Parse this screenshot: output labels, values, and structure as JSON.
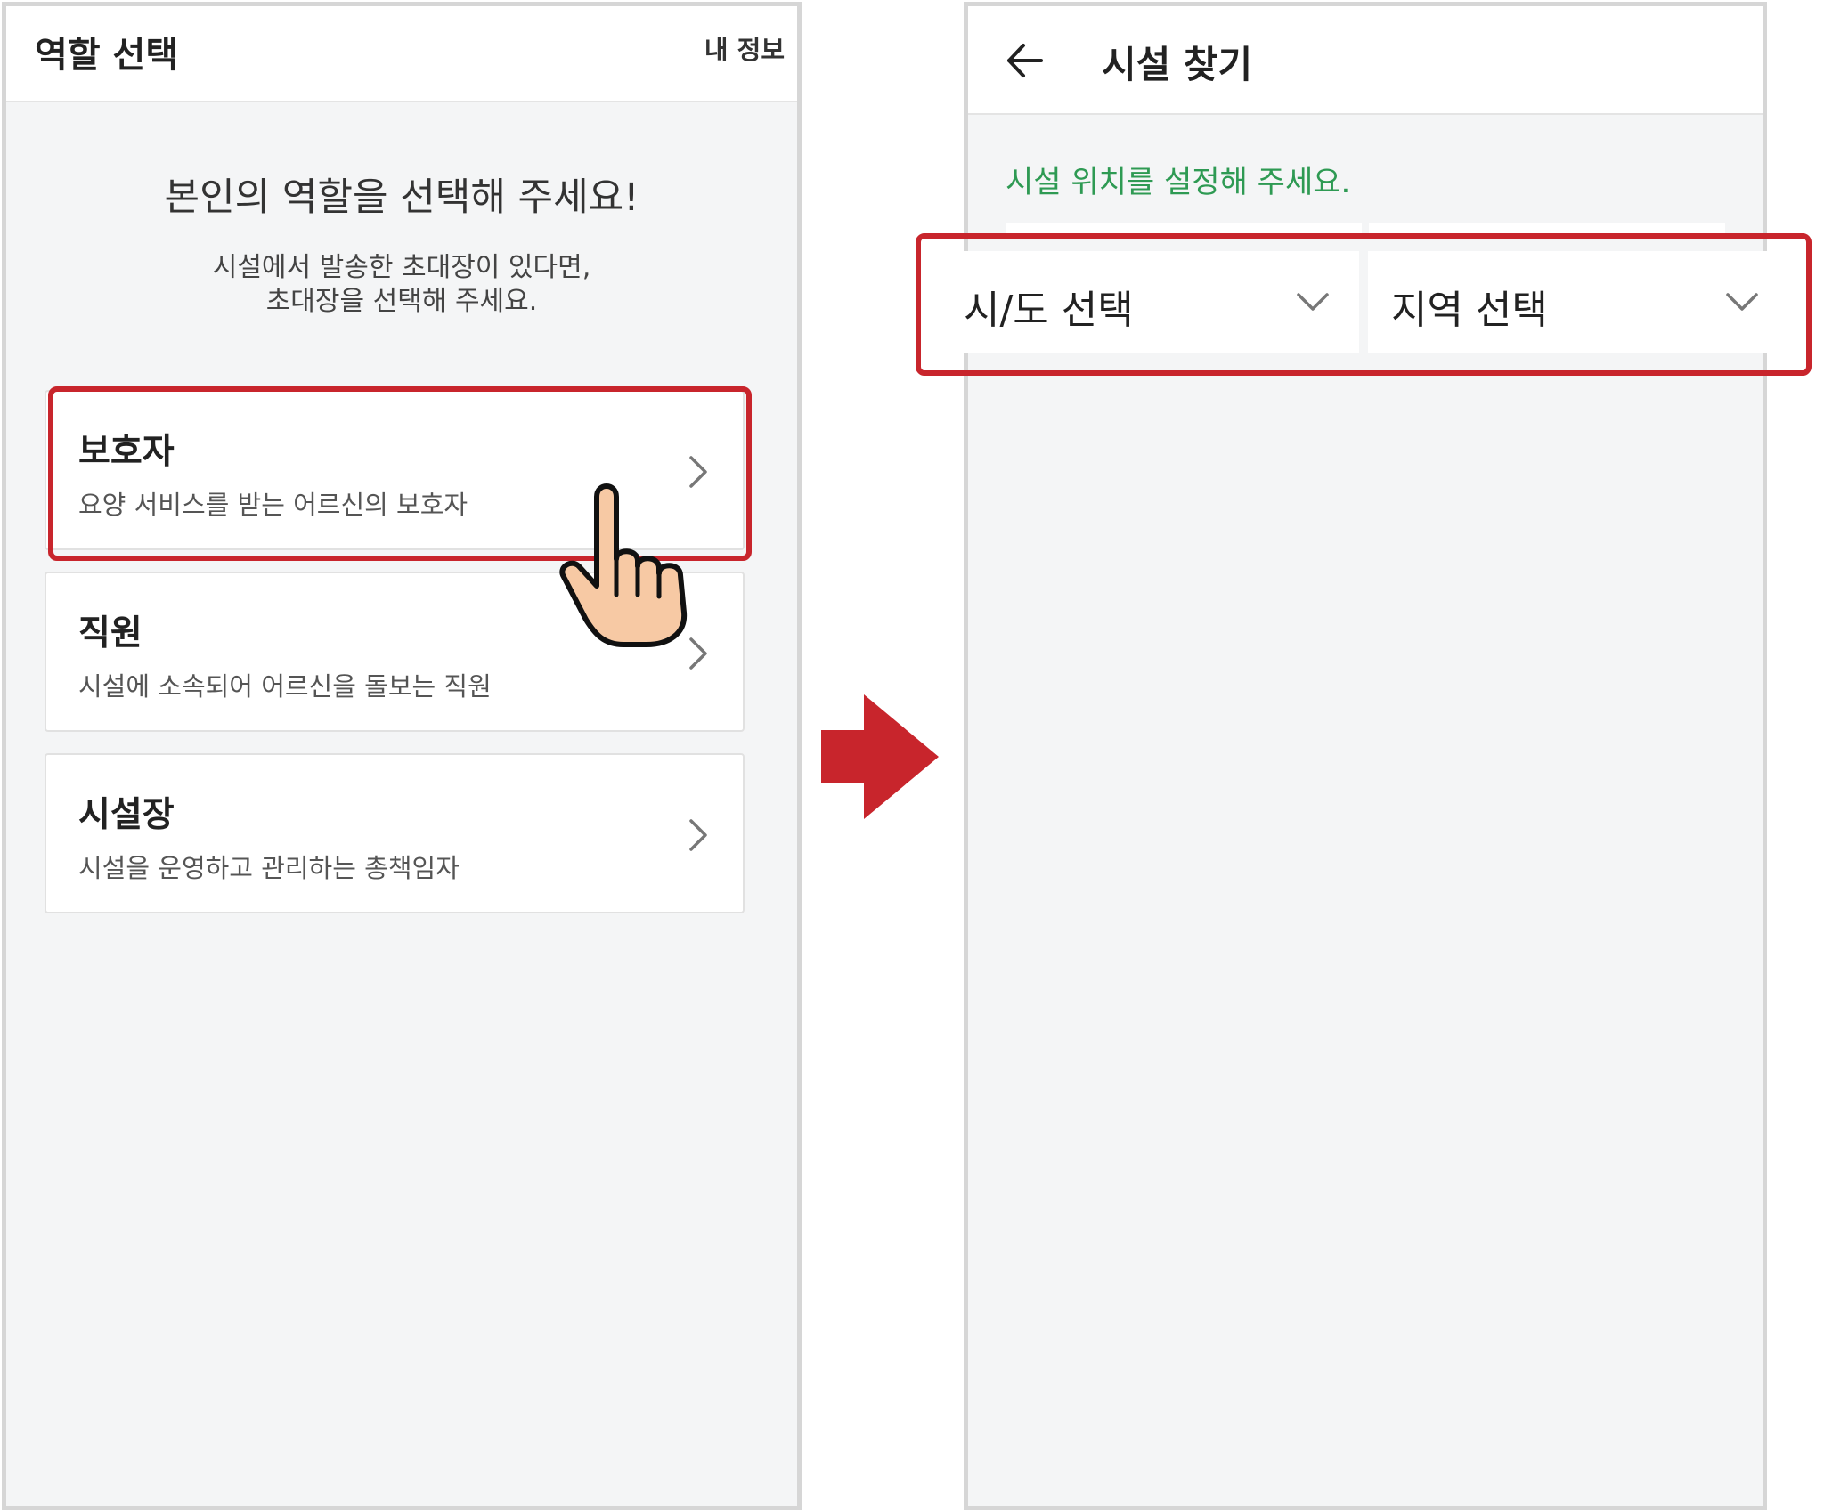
{
  "left_screen": {
    "title": "역할 선택",
    "my_info": "내 정보",
    "heading": "본인의 역할을 선택해 주세요!",
    "subtext_line1": "시설에서 발송한 초대장이 있다면,",
    "subtext_line2": "초대장을 선택해 주세요.",
    "roles": [
      {
        "title": "보호자",
        "description": "요양 서비스를 받는 어르신의 보호자"
      },
      {
        "title": "직원",
        "description": "시설에 소속되어 어르신을 돌보는 직원"
      },
      {
        "title": "시설장",
        "description": "시설을 운영하고 관리하는 총책임자"
      }
    ]
  },
  "right_screen": {
    "title": "시설 찾기",
    "prompt": "시설 위치를 설정해 주세요.",
    "province_select": "시/도 선택",
    "region_select": "지역 선택"
  },
  "colors": {
    "highlight": "#c8252c",
    "prompt_green": "#2e9a53",
    "arrow_red": "#c8252c",
    "hand_fill": "#f7c9a4"
  },
  "icons": [
    "back-arrow-icon",
    "chevron-right-icon",
    "chevron-down-icon",
    "pointing-hand-icon",
    "right-arrow-icon"
  ]
}
